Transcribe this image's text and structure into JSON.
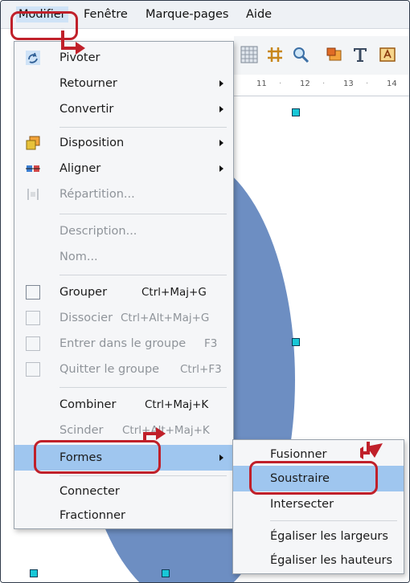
{
  "menubar": {
    "items": [
      {
        "label": "Modifier"
      },
      {
        "label": "Fenêtre"
      },
      {
        "label": "Marque-pages"
      },
      {
        "label": "Aide"
      }
    ]
  },
  "ruler": {
    "ticks": [
      "11",
      "12",
      "13",
      "14"
    ]
  },
  "modifier_menu": {
    "items": [
      {
        "label": "Pivoter"
      },
      {
        "label": "Retourner"
      },
      {
        "label": "Convertir"
      },
      {
        "label": "Disposition"
      },
      {
        "label": "Aligner"
      },
      {
        "label": "Répartition..."
      },
      {
        "label": "Description..."
      },
      {
        "label": "Nom..."
      },
      {
        "label": "Grouper",
        "shortcut": "Ctrl+Maj+G"
      },
      {
        "label": "Dissocier",
        "shortcut": "Ctrl+Alt+Maj+G"
      },
      {
        "label": "Entrer dans le groupe",
        "shortcut": "F3"
      },
      {
        "label": "Quitter le groupe",
        "shortcut": "Ctrl+F3"
      },
      {
        "label": "Combiner",
        "shortcut": "Ctrl+Maj+K"
      },
      {
        "label": "Scinder",
        "shortcut": "Ctrl+Alt+Maj+K"
      },
      {
        "label": "Formes"
      },
      {
        "label": "Connecter"
      },
      {
        "label": "Fractionner"
      }
    ]
  },
  "formes_menu": {
    "items": [
      {
        "label": "Fusionner"
      },
      {
        "label": "Soustraire"
      },
      {
        "label": "Intersecter"
      },
      {
        "label": "Égaliser les largeurs"
      },
      {
        "label": "Égaliser les hauteurs"
      }
    ]
  },
  "colors": {
    "highlight": "#9fc6ef",
    "shape": "#6d8ec2",
    "annotation": "#c0202a"
  }
}
